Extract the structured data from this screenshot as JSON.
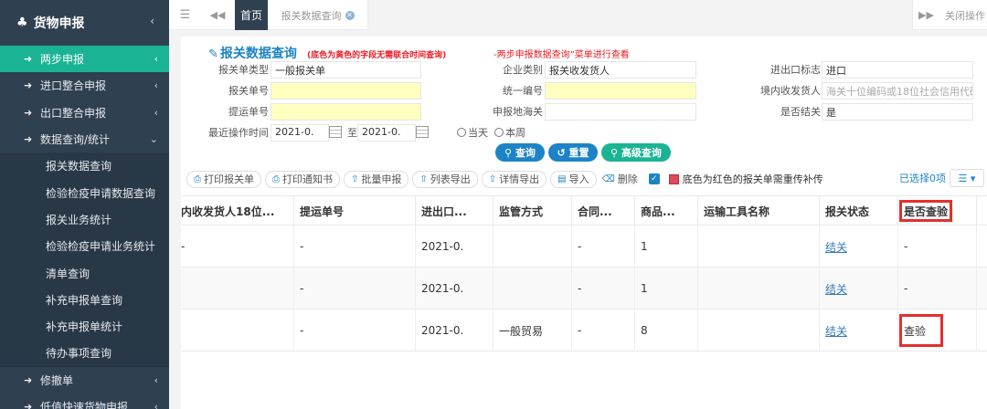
{
  "sidebar": {
    "header": "货物申报",
    "items": [
      {
        "label": "两步申报",
        "active": true
      },
      {
        "label": "进口整合申报"
      },
      {
        "label": "出口整合申报"
      },
      {
        "label": "数据查询/统计"
      }
    ],
    "subitems": [
      "报关数据查询",
      "检验检疫申请数据查询",
      "报关业务统计",
      "检验检疫申请业务统计",
      "清单查询",
      "补充申报单查询",
      "补充申报单统计",
      "待办事项查询"
    ],
    "bottom_items": [
      {
        "label": "修撤单"
      },
      {
        "label": "低值快速货物申报"
      }
    ]
  },
  "topbar": {
    "home": "首页",
    "tab": "报关数据查询",
    "close_ops": "关闭操作"
  },
  "form": {
    "title": "报关数据查询",
    "note": "(底色为黄色的字段无需联合时间查询)",
    "note2": "-两步申报数据查询”菜单进行查看",
    "labels": {
      "entry_type": "报关单类型",
      "company_type": "企业类别",
      "ie_flag": "进出口标志",
      "entry_no": "报关单号",
      "unified_no": "统一编号",
      "consignee": "境内收发货人",
      "bill_no": "提运单号",
      "customs": "申报地海关",
      "is_closed": "是否结关",
      "op_time": "最近操作时间"
    },
    "values": {
      "entry_type": "一般报关单",
      "company_type": "报关收发货人",
      "ie_flag": "进口",
      "consignee_ph": "海关十位编码或18位社会信用代码",
      "is_closed": "是",
      "date_from": "2021-0.",
      "date_to": "2021-0.",
      "to_sep": "至"
    },
    "radios": [
      "当天",
      "本周"
    ],
    "buttons": {
      "query": "查询",
      "reset": "重置",
      "advanced": "高级查询"
    }
  },
  "toolbar": {
    "buttons": [
      "打印报关单",
      "打印通知书",
      "批量申报",
      "列表导出",
      "详情导出",
      "导入",
      "删除"
    ],
    "note": "底色为红色的报关单需重传补传",
    "selected": "已选择0项"
  },
  "table": {
    "headers": [
      "内收发货人18位...",
      "提运单号",
      "进出口...",
      "监管方式",
      "合同...",
      "商品...",
      "运输工具名称",
      "报关状态",
      "是否查验"
    ],
    "rows": [
      {
        "c1": "-",
        "c2": "-",
        "c3": "2021-0.",
        "c4": "",
        "c5": "-",
        "c6": "1",
        "c7": "",
        "c8": "结关",
        "c9": "-"
      },
      {
        "c1": "",
        "c2": "-",
        "c3": "2021-0.",
        "c4": "",
        "c5": "-",
        "c6": "1",
        "c7": "",
        "c8": "结关",
        "c9": "-"
      },
      {
        "c1": "",
        "c2": "-",
        "c3": "2021-0.",
        "c4": "一般贸易",
        "c5": "-",
        "c6": "8",
        "c7": "",
        "c8": "结关",
        "c9": "查验"
      }
    ]
  },
  "colors": {
    "sidebar_bg": "#2f4050",
    "active": "#1ab394",
    "primary": "#1c84c6",
    "highlight": "#e62e2e"
  }
}
